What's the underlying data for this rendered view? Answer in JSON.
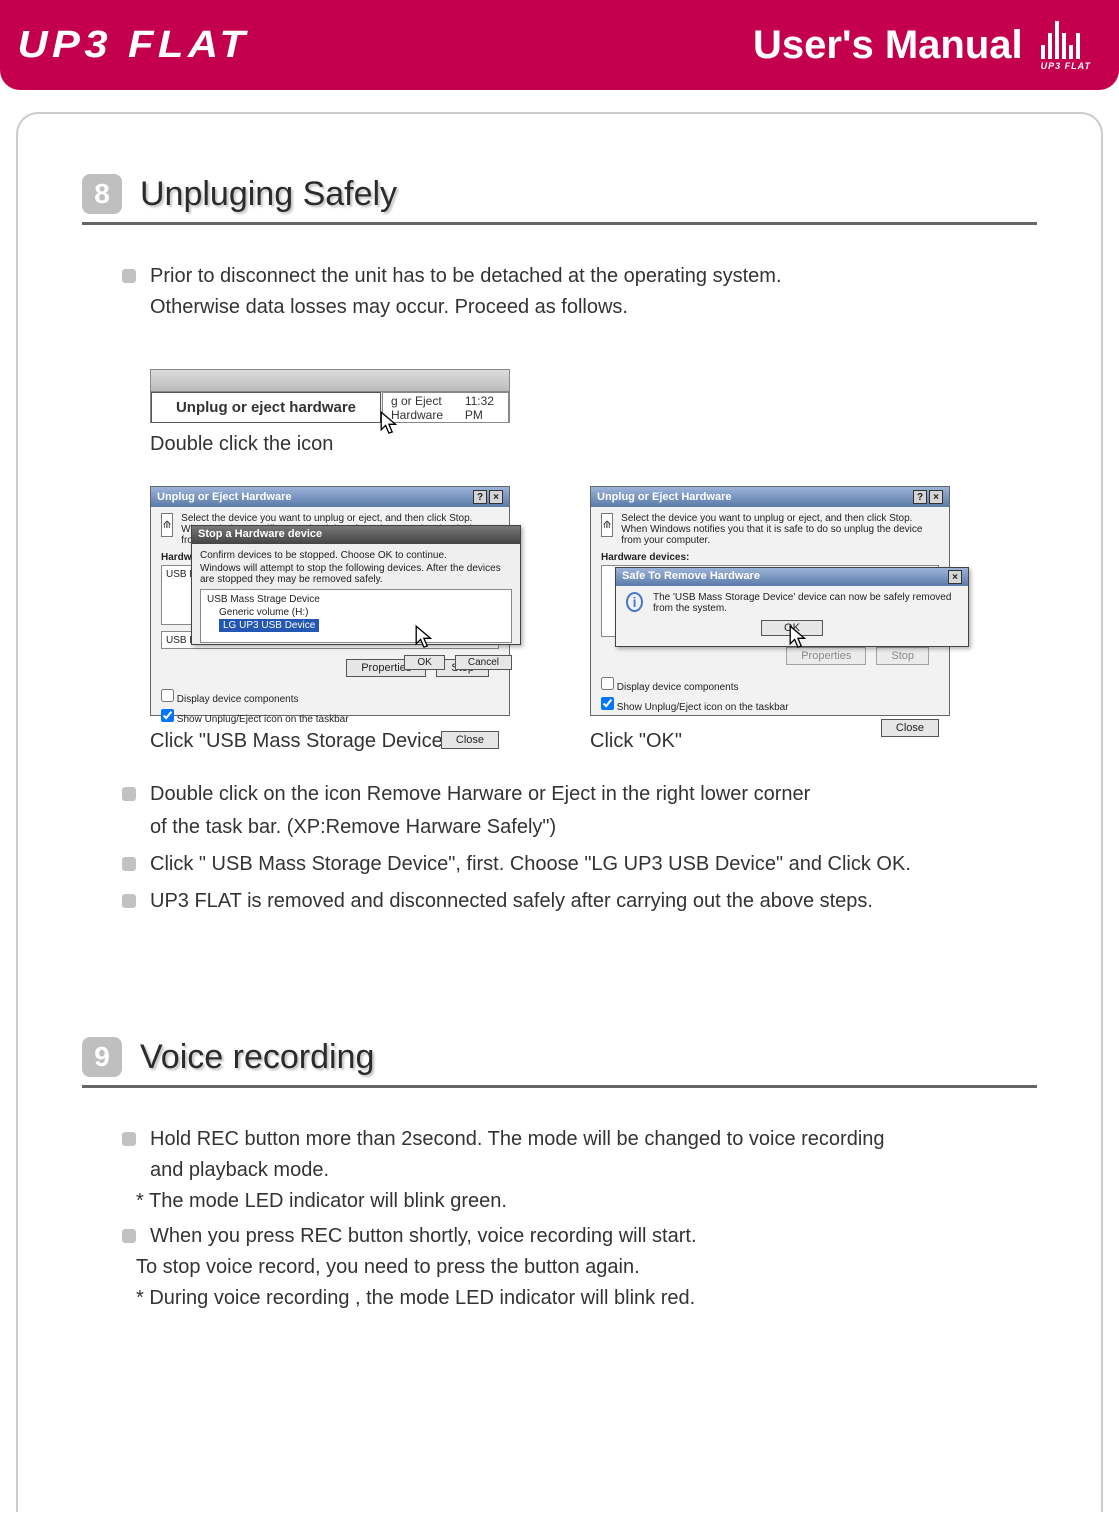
{
  "banner": {
    "logo": "UP3 FLAT",
    "title": "User's Manual",
    "mini_label": "UP3 FLAT"
  },
  "section8": {
    "number": "8",
    "title": "Unpluging Safely",
    "intro": "Prior to disconnect the unit has to be detached at the operating system.",
    "intro2": "Otherwise data losses may occur. Proceed as follows.",
    "fig1": {
      "tooltip": "Unplug or eject hardware",
      "tray_text": "g or Eject Hardware",
      "time": "11:32 PM",
      "caption": "Double click the icon"
    },
    "fig2": {
      "title": "Unplug or Eject Hardware",
      "help": "Select the device you want to unplug or eject, and then click Stop. When Windows notifies you that it is safe to do so unplug the device from your computer.",
      "hw_label": "Hardware devices:",
      "list_item1": "USB Mass Stor",
      "list_item2": "USB Mass Storage D",
      "chk1": "Display device components",
      "chk2": "Show Unplug/Eject icon on the taskbar",
      "close": "Close",
      "properties": "Properties",
      "stop": "Stop",
      "inner_title": "Stop a Hardware device",
      "inner_help": "Confirm devices to be stopped. Choose OK to continue.",
      "inner_help2": "Windows will attempt to stop the following devices. After the devices are stopped they may be removed safely.",
      "tree1": "USB Mass Strage Device",
      "tree2": "Generic volume (H:)",
      "tree3": "LG UP3   USB Device",
      "ok": "OK",
      "cancel": "Cancel",
      "caption": "Click \"USB Mass Storage Device\""
    },
    "fig3": {
      "title": "Unplug or Eject Hardware",
      "help": "Select the device you want to unplug or eject, and then click Stop. When Windows notifies you that it is safe to do so unplug the device from your computer.",
      "hw_label": "Hardware devices:",
      "chk1": "Display device components",
      "chk2": "Show Unplug/Eject icon on the taskbar",
      "close": "Close",
      "properties": "Properties",
      "stop": "Stop",
      "overlay_title": "Safe To Remove Hardware",
      "overlay_msg": "The 'USB Mass Storage Device' device can now be safely removed from the system.",
      "ok": "OK",
      "caption": "Click \"OK\""
    },
    "bullets": {
      "b1": "Double click on the icon Remove Harware or Eject in the right lower corner",
      "b1b": "of the task bar. (XP:Remove Harware Safely\")",
      "b2": "Click \" USB Mass Storage Device\", first. Choose \"LG UP3 USB Device\" and Click OK.",
      "b3": "UP3 FLAT  is removed and disconnected safely after carrying out  the above steps."
    }
  },
  "section9": {
    "number": "9",
    "title": "Voice recording",
    "b1": "Hold REC button more than 2second. The mode will be changed to voice recording",
    "b1b": "and playback mode.",
    "b1c": "* The mode LED indicator will blink green.",
    "b2": "When you press REC button shortly, voice recording will start.",
    "b2b": "To stop voice record, you need to press the button again.",
    "b2c": "* During voice recording , the mode LED indicator will blink red."
  }
}
